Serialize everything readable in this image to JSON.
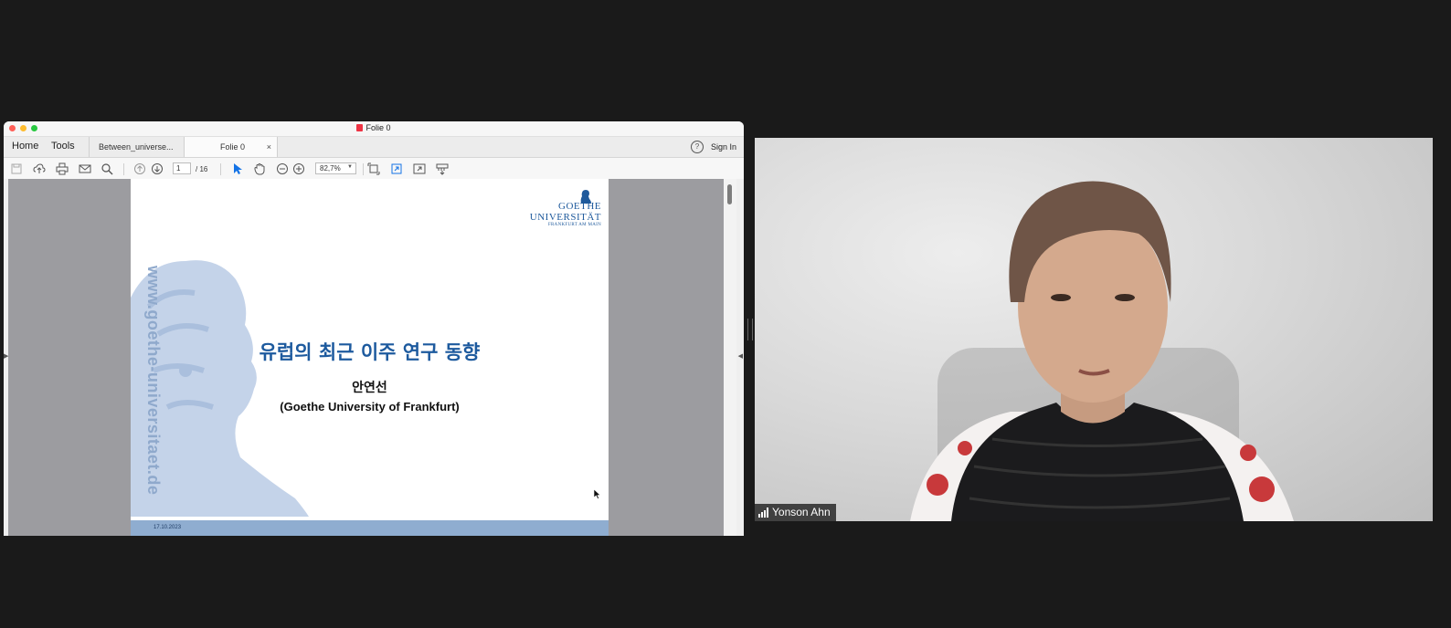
{
  "window": {
    "title": "Folie 0"
  },
  "tabbar": {
    "home": "Home",
    "tools": "Tools",
    "tabs": [
      {
        "label": "Between_universe..."
      },
      {
        "label": "Folie 0",
        "close": "×"
      }
    ],
    "help": "?",
    "sign_in": "Sign In"
  },
  "toolbar": {
    "page_current": "1",
    "page_total": "/ 16",
    "zoom": "82,7%",
    "icons": [
      "save-icon",
      "upload-icon",
      "print-icon",
      "mail-icon",
      "search-icon",
      "page-up-icon",
      "page-down-icon",
      "select-cursor-icon",
      "hand-icon",
      "zoom-out-icon",
      "zoom-in-icon",
      "fit-page-icon",
      "rotate-icon",
      "fullscreen-icon",
      "read-mode-icon"
    ]
  },
  "slide": {
    "logo_line1": "GOETHE",
    "logo_line2": "UNIVERSITÄT",
    "logo_line3": "FRANKFURT AM MAIN",
    "vertical_url": "www.goethe-universitaet.de",
    "title": "유럽의 최근 이주 연구 동향",
    "author": "안연선",
    "affiliation": "(Goethe University of Frankfurt)",
    "date": "17.10.2023"
  },
  "video": {
    "participant_name": "Yonson Ahn"
  },
  "colors": {
    "goethe_blue": "#1d5a9e",
    "footer_blue": "#8fadd0",
    "background": "#1a1a1a"
  }
}
